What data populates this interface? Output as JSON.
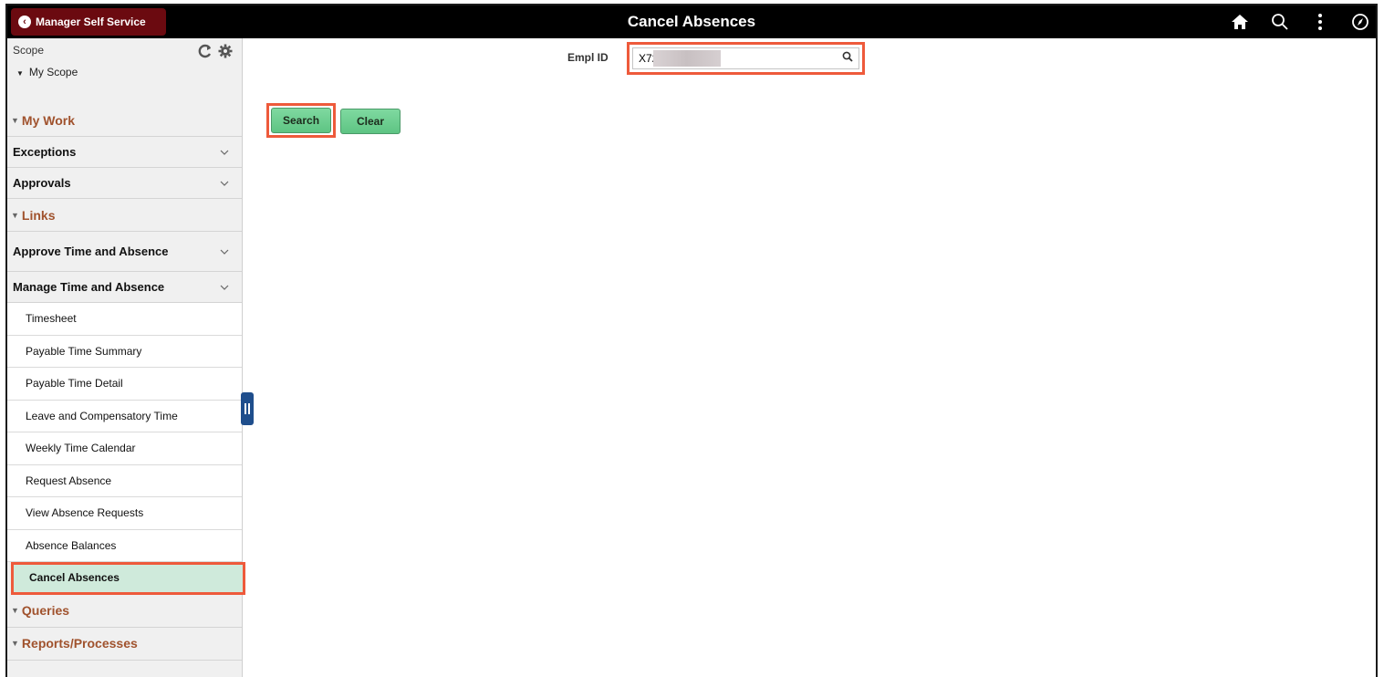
{
  "header": {
    "back_label": "Manager Self Service",
    "title": "Cancel Absences",
    "icons": [
      "home-icon",
      "search-icon",
      "more-vertical-icon",
      "navbar-compass-icon"
    ]
  },
  "sidebar": {
    "scope_label": "Scope",
    "my_scope": "My Scope",
    "sections": [
      {
        "title": "My Work",
        "groups": [
          "Exceptions",
          "Approvals"
        ]
      },
      {
        "title": "Links",
        "groups": [
          "Approve Time and Absence",
          "Manage Time and Absence"
        ],
        "sub_items": [
          "Timesheet",
          "Payable Time Summary",
          "Payable Time Detail",
          "Leave and Compensatory Time",
          "Weekly Time Calendar",
          "Request Absence",
          "View Absence Requests",
          "Absence Balances",
          "Cancel Absences"
        ],
        "selected": "Cancel Absences"
      },
      {
        "title": "Queries"
      },
      {
        "title": "Reports/Processes"
      }
    ]
  },
  "form": {
    "empl_id_label": "Empl ID",
    "empl_id_value": "X72",
    "search_label": "Search",
    "clear_label": "Clear"
  },
  "colors": {
    "topbar": "#000000",
    "back_button": "#6b0a10",
    "highlight": "#ee5a3b",
    "section_title": "#a0522d",
    "button_green": "#5ec483",
    "selected_bg": "#cfeadb"
  }
}
